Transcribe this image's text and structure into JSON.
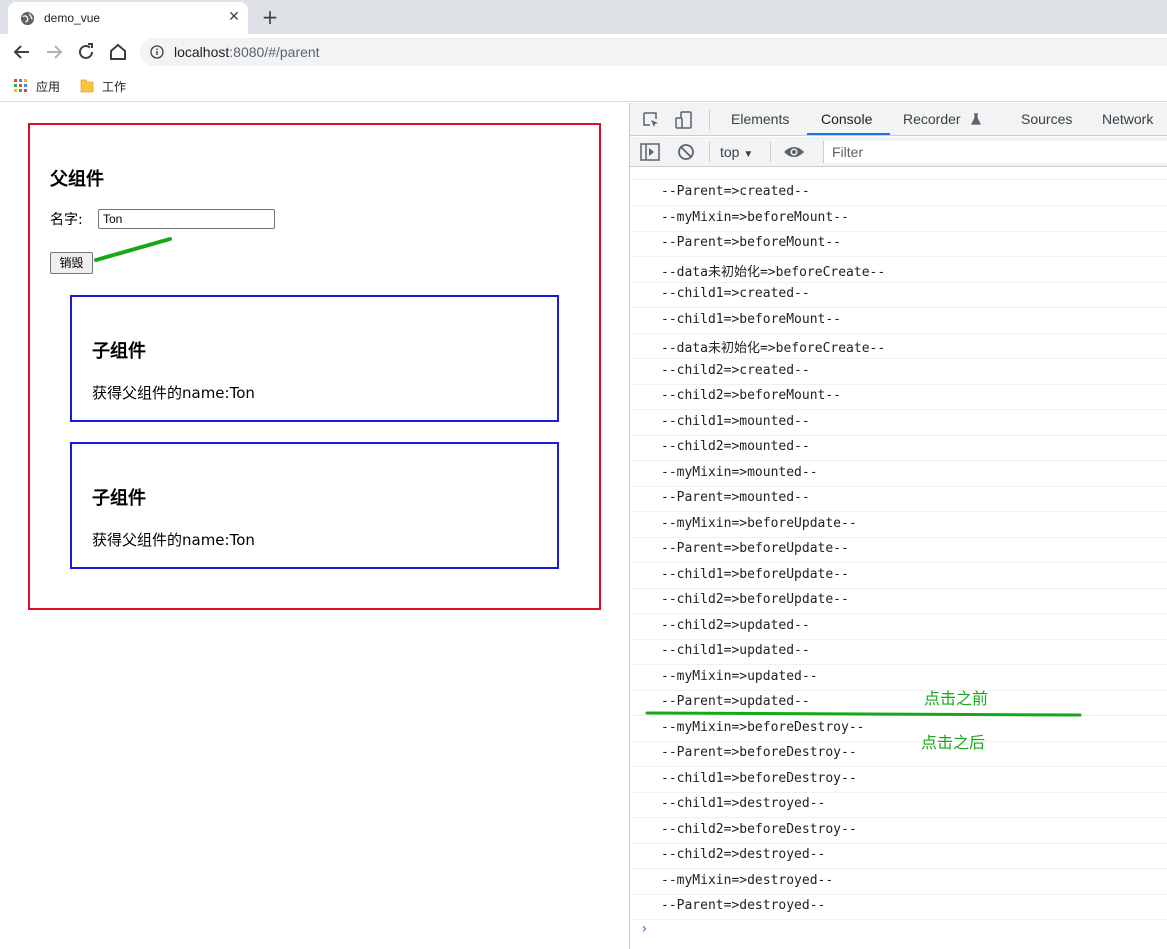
{
  "browser": {
    "tab_title": "demo_vue",
    "tab_close": "✕",
    "new_tab": "+",
    "url_host": "localhost",
    "url_rest": ":8080/#/parent",
    "bookmarks": [
      {
        "label": "应用",
        "icon": "apps-grid-icon"
      },
      {
        "label": "工作",
        "icon": "folder-icon"
      }
    ]
  },
  "page": {
    "parent_title": "父组件",
    "name_label": "名字:",
    "name_value": "Ton",
    "destroy_button": "销毁",
    "children": [
      {
        "title": "子组件",
        "text": "获得父组件的name:Ton"
      },
      {
        "title": "子组件",
        "text": "获得父组件的name:Ton"
      }
    ]
  },
  "devtools": {
    "tabs": [
      "Elements",
      "Console",
      "Recorder",
      "Sources",
      "Network"
    ],
    "active_tab": "Console",
    "context": "top",
    "filter_placeholder": "Filter",
    "prompt": "›",
    "logs": [
      "--Parent=>created--",
      "--myMixin=>beforeMount--",
      "--Parent=>beforeMount--",
      "--data未初始化=>beforeCreate--",
      "--child1=>created--",
      "--child1=>beforeMount--",
      "--data未初始化=>beforeCreate--",
      "--child2=>created--",
      "--child2=>beforeMount--",
      "--child1=>mounted--",
      "--child2=>mounted--",
      "--myMixin=>mounted--",
      "--Parent=>mounted--",
      "--myMixin=>beforeUpdate--",
      "--Parent=>beforeUpdate--",
      "--child1=>beforeUpdate--",
      "--child2=>beforeUpdate--",
      "--child2=>updated--",
      "--child1=>updated--",
      "--myMixin=>updated--",
      "--Parent=>updated--",
      "--myMixin=>beforeDestroy--",
      "--Parent=>beforeDestroy--",
      "--child1=>beforeDestroy--",
      "--child1=>destroyed--",
      "--child2=>beforeDestroy--",
      "--child2=>destroyed--",
      "--myMixin=>destroyed--",
      "--Parent=>destroyed--"
    ]
  },
  "annotations": {
    "before_click": "点击之前",
    "after_click": "点击之后",
    "color": "#17a81a"
  }
}
